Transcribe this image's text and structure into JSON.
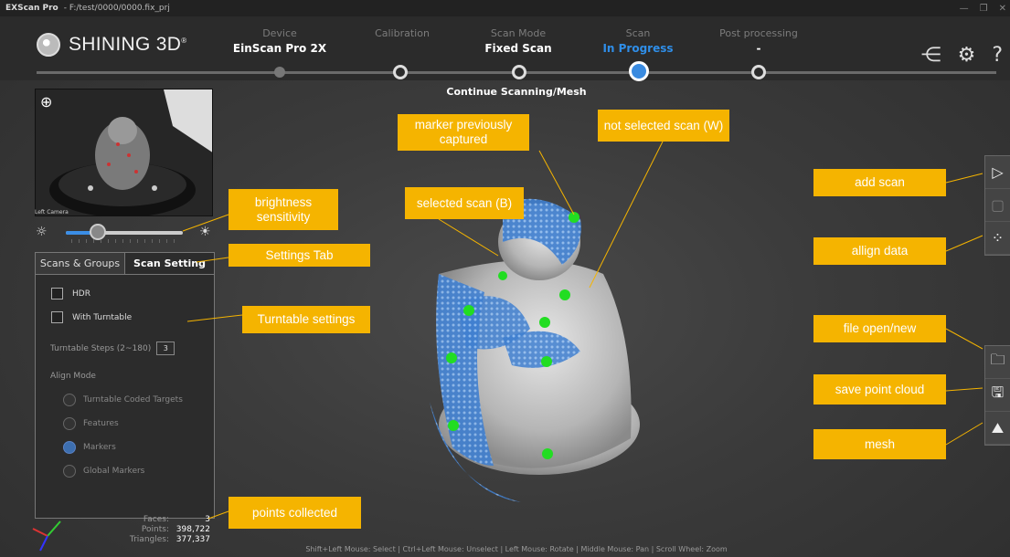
{
  "window": {
    "app": "EXScan Pro",
    "path": "- F:/test/0000/0000.fix_prj"
  },
  "brand": {
    "logo": "SHINING 3D",
    "reg": "®"
  },
  "steps": [
    {
      "label": "Device",
      "value": "EinScan Pro 2X"
    },
    {
      "label": "Calibration",
      "value": ""
    },
    {
      "label": "Scan Mode",
      "value": "Fixed Scan"
    },
    {
      "label": "Scan",
      "value": "In Progress"
    },
    {
      "label": "Post processing",
      "value": "-"
    }
  ],
  "subtitle": "Continue Scanning/Mesh",
  "camera": {
    "label": "Left Camera"
  },
  "panel": {
    "tabs": [
      "Scans & Groups",
      "Scan Setting"
    ],
    "hdr": "HDR",
    "turntable": "With Turntable",
    "steps_label": "Turntable Steps (2~180)",
    "steps_value": "3",
    "align_mode": "Align Mode",
    "align_options": [
      "Turntable Coded Targets",
      "Features",
      "Markers",
      "Global Markers"
    ],
    "align_selected": "Markers"
  },
  "stats": [
    {
      "k": "Faces:",
      "v": "3"
    },
    {
      "k": "Points:",
      "v": "398,722"
    },
    {
      "k": "Triangles:",
      "v": "377,337"
    }
  ],
  "status_bar": "Shift+Left Mouse: Select | Ctrl+Left Mouse: Unselect | Left Mouse: Rotate | Middle Mouse: Pan | Scroll Wheel: Zoom",
  "annotations": {
    "marker_prev": "marker previously captured",
    "not_selected": "not selected scan (W)",
    "selected": "selected scan (B)",
    "brightness": "brightness sensitivity",
    "settings_tab": "Settings Tab",
    "turntable": "Turntable settings",
    "points": "points collected",
    "add_scan": "add scan",
    "align": "allign data",
    "file": "file open/new",
    "save": "save point cloud",
    "mesh": "mesh"
  },
  "icons": [
    "share-icon",
    "gear-icon",
    "help-icon",
    "zoom-in-icon",
    "play-icon",
    "align-icon",
    "folder-icon",
    "save-icon",
    "mesh-icon"
  ],
  "colors": {
    "accent": "#2f8ee8",
    "annotation": "#f5b400",
    "marker": "#22dd22"
  }
}
